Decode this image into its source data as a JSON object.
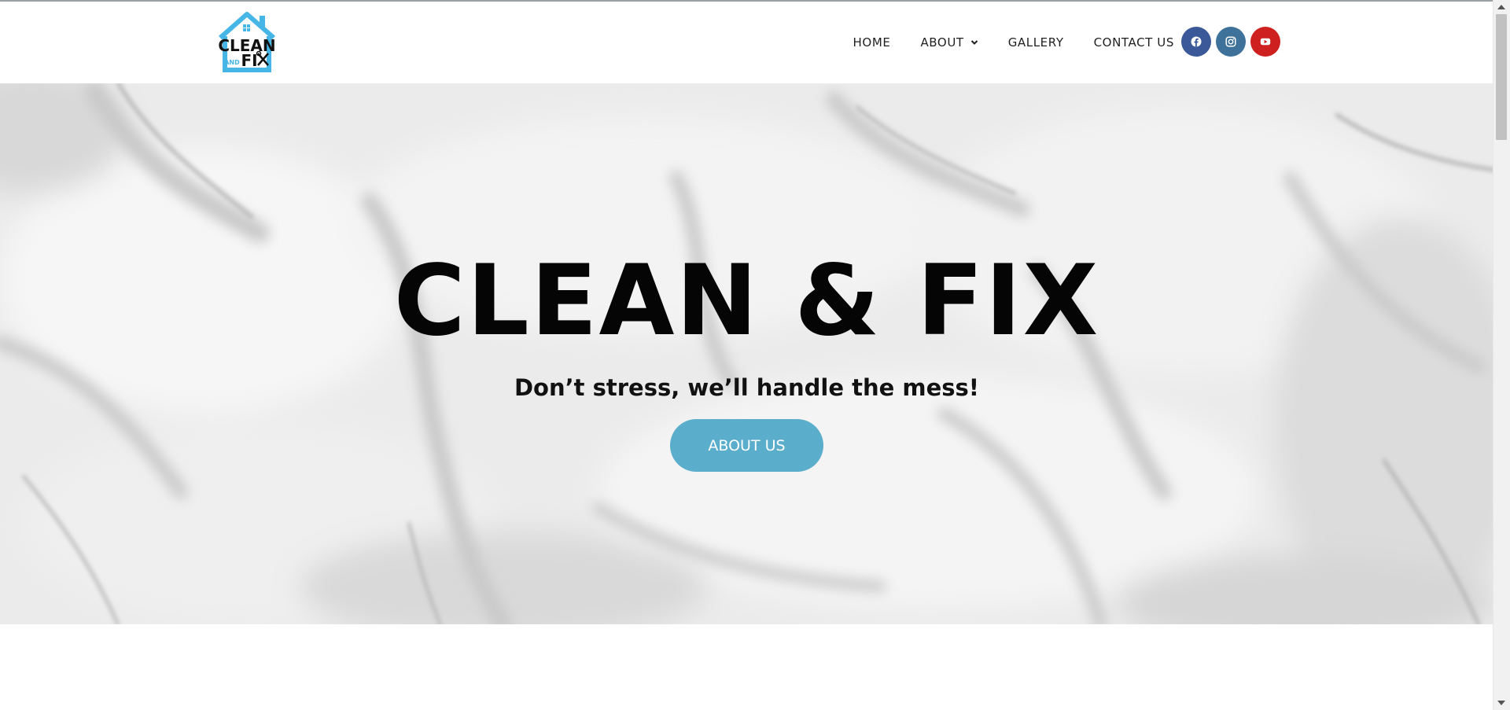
{
  "header": {
    "logo_alt": "Clean and Fix",
    "logo_text_top": "CLEAN",
    "logo_text_and": "AND",
    "logo_text_fix": "FI",
    "nav": [
      {
        "label": "HOME"
      },
      {
        "label": "ABOUT",
        "has_dropdown": true
      },
      {
        "label": "GALLERY"
      },
      {
        "label": "CONTACT US"
      }
    ],
    "social": [
      {
        "icon": "facebook-icon",
        "color": "#3b5998"
      },
      {
        "icon": "instagram-icon",
        "color": "#3f729b"
      },
      {
        "icon": "youtube-icon",
        "color": "#cd201f"
      }
    ]
  },
  "hero": {
    "title": "CLEAN & FIX",
    "subtitle": "Don’t stress, we’ll handle the mess!",
    "button_label": "ABOUT US",
    "button_color": "#5aaecb",
    "background": "white-bedsheet-photo"
  },
  "colors": {
    "accent": "#5aaecb",
    "logo_blue": "#45b6e6",
    "text": "#111111"
  }
}
